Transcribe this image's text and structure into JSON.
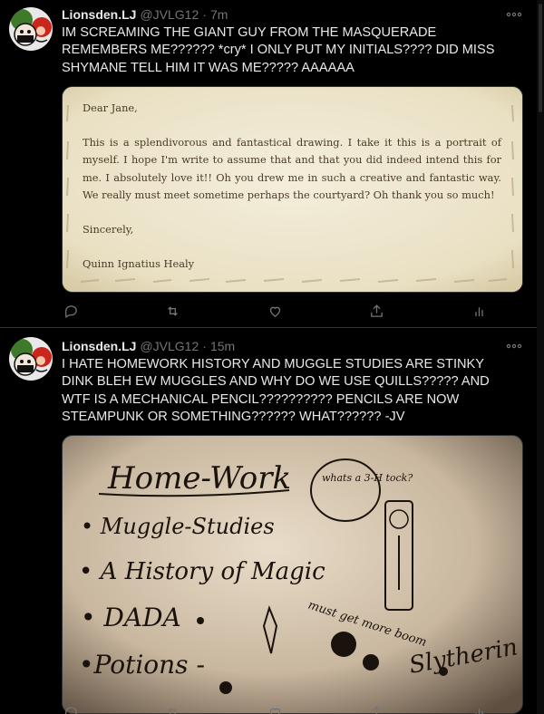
{
  "tweets": [
    {
      "author": {
        "display_name": "Lionsden.LJ",
        "handle": "@JVLG12",
        "separator": "·",
        "time": "7m"
      },
      "text": "IM SCREAMING THE GIANT GUY FROM THE MASQUERADE REMEMBERS ME?????? *cry* I ONLY PUT MY INITIALS???? DID MISS SHYMANE TELL HIM IT WAS ME????? AAAAAA",
      "letter": {
        "greeting": "Dear Jane,",
        "body": "This is a splendivorous and fantastical drawing. I take it this is a portrait of myself. I hope I'm write to assume that and that you did indeed intend this for me. I absolutely love it!! Oh you drew me in such a creative and fantastic way. We really must meet sometime perhaps the courtyard? Oh thank you so much!",
        "closing": "Sincerely,",
        "signature": "Quinn Ignatius Healy"
      }
    },
    {
      "author": {
        "display_name": "Lionsden.LJ",
        "handle": "@JVLG12",
        "separator": "·",
        "time": "15m"
      },
      "text": "I HATE HOMEWORK HISTORY AND MUGGLE STUDIES ARE STINKY DINK BLEH EW MUGGLES AND WHY DO WE USE QUILLS????? AND WTF IS A MECHANICAL PENCIL?????????? PENCILS ARE NOW STEAMPUNK OR SOMETHING?????? WHAT?????? -JV",
      "drawing": {
        "title": "Home-Work",
        "items": [
          "• Muggle-Studies",
          "• A History of Magic",
          "• DADA",
          "•Potions - "
        ],
        "bubble": "whats a 3-H tock?",
        "side_note": "must get more boom",
        "signature": "Slytherin"
      }
    }
  ],
  "icons": {
    "avatar": "avatar-image",
    "more": "more-icon",
    "reply": "reply-icon",
    "retweet": "retweet-icon",
    "like": "like-icon",
    "share": "share-icon",
    "analytics": "analytics-icon"
  },
  "colors": {
    "background": "#000000",
    "text": "#e7e9ea",
    "secondary": "#71767b",
    "divider": "#2f3336",
    "letter_paper": "#f1ead2",
    "letter_ink": "#4a3a28"
  }
}
